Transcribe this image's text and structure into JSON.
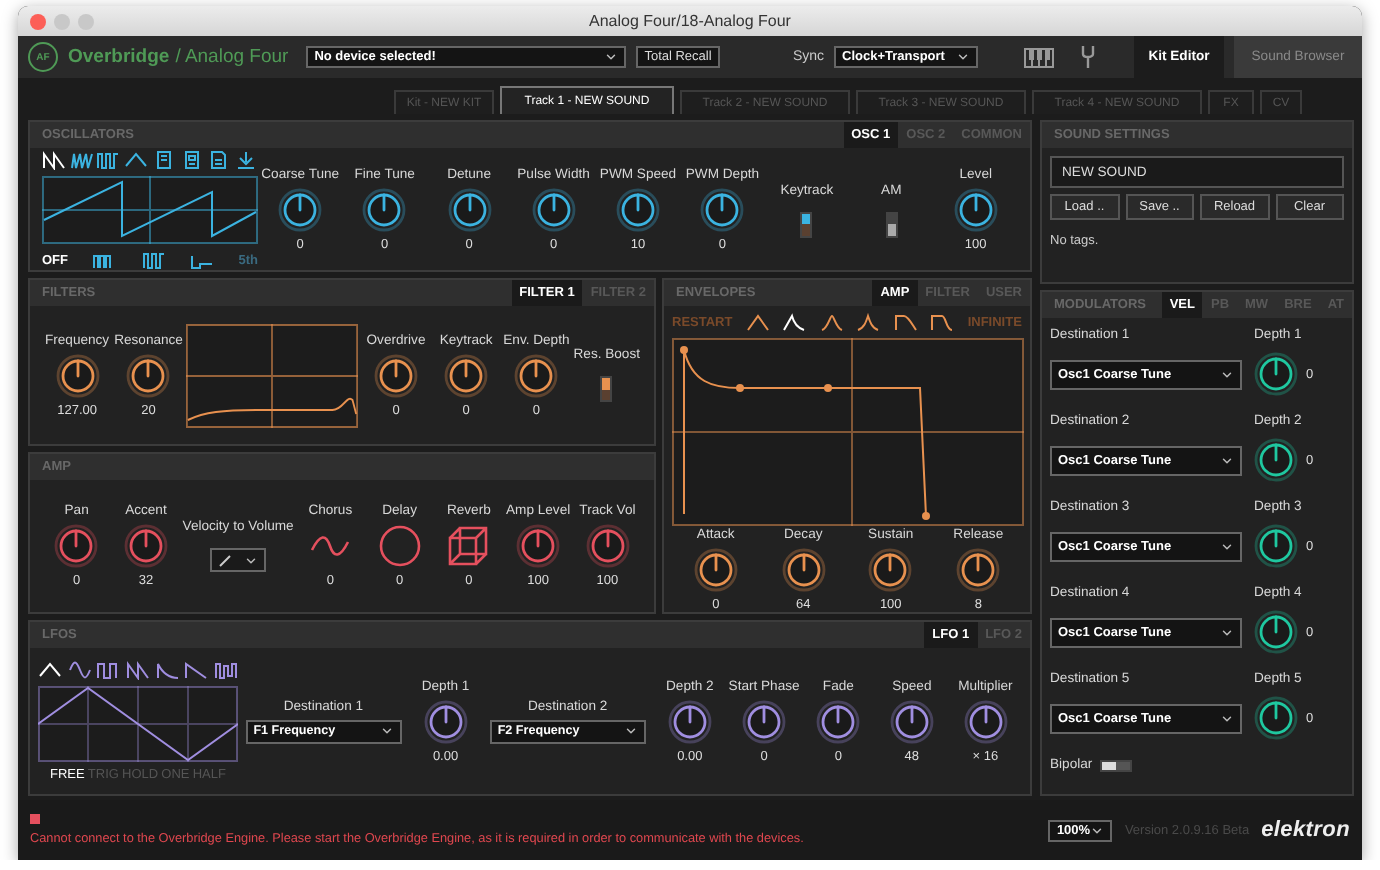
{
  "window": {
    "title": "Analog Four/18-Analog Four"
  },
  "header": {
    "logo": "AF",
    "brand": "Overbridge",
    "product": "/ Analog Four",
    "device": {
      "value": "No device selected!"
    },
    "total_recall": "Total Recall",
    "sync_label": "Sync",
    "sync": {
      "value": "Clock+Transport"
    },
    "views": [
      {
        "label": "Kit Editor",
        "selected": true
      },
      {
        "label": "Sound Browser",
        "selected": false
      }
    ]
  },
  "track_tabs": [
    {
      "label": "Kit - NEW KIT",
      "selected": false
    },
    {
      "label": "Track 1 - NEW SOUND",
      "selected": true
    },
    {
      "label": "Track 2 - NEW SOUND",
      "selected": false
    },
    {
      "label": "Track 3 - NEW SOUND",
      "selected": false
    },
    {
      "label": "Track 4 - NEW SOUND",
      "selected": false
    },
    {
      "label": "FX",
      "selected": false
    },
    {
      "label": "CV",
      "selected": false
    }
  ],
  "oscillators": {
    "title": "OSCILLATORS",
    "tabs": [
      {
        "label": "OSC 1",
        "selected": true
      },
      {
        "label": "OSC 2",
        "selected": false
      },
      {
        "label": "COMMON",
        "selected": false
      }
    ],
    "waveforms": [
      {
        "kind": "saw",
        "selected": true
      },
      {
        "kind": "pulse-sweep",
        "selected": false
      },
      {
        "kind": "pulse",
        "selected": false
      },
      {
        "kind": "triangle",
        "selected": false
      },
      {
        "kind": "noise",
        "selected": false
      },
      {
        "kind": "noise-alt",
        "selected": false
      },
      {
        "kind": "sample",
        "selected": false
      },
      {
        "kind": "input",
        "selected": false
      }
    ],
    "sub_modes": [
      {
        "kind": "text",
        "label": "OFF",
        "selected": true
      },
      {
        "kind": "pulse-stack",
        "selected": false
      },
      {
        "kind": "pulse",
        "selected": false
      },
      {
        "kind": "pulse-short",
        "selected": false
      },
      {
        "kind": "text",
        "label": "5th",
        "selected": false
      }
    ],
    "controls": [
      {
        "kind": "knob",
        "label": "Coarse Tune",
        "reading": "0"
      },
      {
        "kind": "knob",
        "label": "Fine Tune",
        "reading": "0"
      },
      {
        "kind": "knob",
        "label": "Detune",
        "reading": "0"
      },
      {
        "kind": "knob",
        "label": "Pulse Width",
        "reading": "0"
      },
      {
        "kind": "knob",
        "label": "PWM Speed",
        "reading": "10"
      },
      {
        "kind": "knob",
        "label": "PWM Depth",
        "reading": "0"
      },
      {
        "kind": "switch",
        "label": "Keytrack",
        "on": true
      },
      {
        "kind": "switch",
        "label": "AM",
        "on": false
      },
      {
        "kind": "knob",
        "label": "Level",
        "reading": "100"
      }
    ]
  },
  "filters": {
    "title": "FILTERS",
    "tabs": [
      {
        "label": "FILTER 1",
        "selected": true
      },
      {
        "label": "FILTER 2",
        "selected": false
      }
    ],
    "controls": [
      {
        "kind": "knob",
        "label": "Frequency",
        "reading": "127.00"
      },
      {
        "kind": "knob",
        "label": "Resonance",
        "reading": "20"
      },
      {
        "kind": "curve"
      },
      {
        "kind": "knob",
        "label": "Overdrive",
        "reading": "0"
      },
      {
        "kind": "knob",
        "label": "Keytrack",
        "reading": "0"
      },
      {
        "kind": "knob",
        "label": "Env. Depth",
        "reading": "0"
      },
      {
        "kind": "switch",
        "label": "Res. Boost",
        "on": true
      }
    ]
  },
  "amp": {
    "title": "AMP",
    "controls": [
      {
        "kind": "knob",
        "label": "Pan",
        "reading": "0"
      },
      {
        "kind": "knob",
        "label": "Accent",
        "reading": "32"
      },
      {
        "kind": "select",
        "label": "Velocity to Volume"
      },
      {
        "kind": "chorus",
        "label": "Chorus",
        "reading": "0"
      },
      {
        "kind": "delay",
        "label": "Delay",
        "reading": "0"
      },
      {
        "kind": "reverb",
        "label": "Reverb",
        "reading": "0"
      },
      {
        "kind": "knob",
        "label": "Amp Level",
        "reading": "100"
      },
      {
        "kind": "knob",
        "label": "Track Vol",
        "reading": "100"
      }
    ]
  },
  "envelopes": {
    "title": "ENVELOPES",
    "tabs": [
      {
        "label": "AMP",
        "selected": true
      },
      {
        "label": "FILTER",
        "selected": false
      },
      {
        "label": "USER",
        "selected": false
      }
    ],
    "shapes": [
      {
        "kind": "text",
        "label": "RESTART",
        "selected": false
      },
      {
        "kind": "attack-decay",
        "selected": false
      },
      {
        "kind": "attack-decay-sharp",
        "selected": true
      },
      {
        "kind": "attack-soft",
        "selected": false
      },
      {
        "kind": "attack-concave",
        "selected": false
      },
      {
        "kind": "gate-decay",
        "selected": false
      },
      {
        "kind": "gate",
        "selected": false
      },
      {
        "kind": "text",
        "label": "INFINITE",
        "selected": false
      }
    ],
    "controls": [
      {
        "kind": "knob",
        "label": "Attack",
        "reading": "0"
      },
      {
        "kind": "knob",
        "label": "Decay",
        "reading": "64"
      },
      {
        "kind": "knob",
        "label": "Sustain",
        "reading": "100"
      },
      {
        "kind": "knob",
        "label": "Release",
        "reading": "8"
      }
    ]
  },
  "lfos": {
    "title": "LFOS",
    "tabs": [
      {
        "label": "LFO 1",
        "selected": true
      },
      {
        "label": "LFO 2",
        "selected": false
      }
    ],
    "waveforms": [
      {
        "kind": "triangle",
        "selected": true
      },
      {
        "kind": "sine",
        "selected": false
      },
      {
        "kind": "square",
        "selected": false
      },
      {
        "kind": "saw",
        "selected": false
      },
      {
        "kind": "exp",
        "selected": false
      },
      {
        "kind": "ramp",
        "selected": false
      },
      {
        "kind": "random",
        "selected": false
      }
    ],
    "modes": [
      {
        "label": "FREE",
        "selected": true
      },
      {
        "label": "TRIG",
        "selected": false
      },
      {
        "label": "HOLD",
        "selected": false
      },
      {
        "label": "ONE",
        "selected": false
      },
      {
        "label": "HALF",
        "selected": false
      }
    ],
    "controls": [
      {
        "kind": "select",
        "label": "Destination 1",
        "value": "F1 Frequency"
      },
      {
        "kind": "knob",
        "label": "Depth 1",
        "reading": "0.00"
      },
      {
        "kind": "select",
        "label": "Destination 2",
        "value": "F2 Frequency"
      },
      {
        "kind": "knob",
        "label": "Depth 2",
        "reading": "0.00"
      },
      {
        "kind": "knob",
        "label": "Start Phase",
        "reading": "0"
      },
      {
        "kind": "knob",
        "label": "Fade",
        "reading": "0"
      },
      {
        "kind": "knob",
        "label": "Speed",
        "reading": "48"
      },
      {
        "kind": "knob",
        "label": "Multiplier",
        "reading": "× 16"
      }
    ]
  },
  "sound_settings": {
    "title": "SOUND SETTINGS",
    "name": "NEW SOUND",
    "buttons": [
      "Load ..",
      "Save ..",
      "Reload",
      "Clear"
    ],
    "tags": "No tags."
  },
  "modulators": {
    "title": "MODULATORS",
    "tabs": [
      {
        "label": "VEL",
        "selected": true
      },
      {
        "label": "PB",
        "selected": false
      },
      {
        "label": "MW",
        "selected": false
      },
      {
        "label": "BRE",
        "selected": false
      },
      {
        "label": "AT",
        "selected": false
      }
    ],
    "destinations": [
      {
        "label": "Destination 1",
        "value": "Osc1 Coarse Tune",
        "depth_label": "Depth 1",
        "reading": "0"
      },
      {
        "label": "Destination 2",
        "value": "Osc1 Coarse Tune",
        "depth_label": "Depth 2",
        "reading": "0"
      },
      {
        "label": "Destination 3",
        "value": "Osc1 Coarse Tune",
        "depth_label": "Depth 3",
        "reading": "0"
      },
      {
        "label": "Destination 4",
        "value": "Osc1 Coarse Tune",
        "depth_label": "Depth 4",
        "reading": "0"
      },
      {
        "label": "Destination 5",
        "value": "Osc1 Coarse Tune",
        "depth_label": "Depth 5",
        "reading": "0"
      }
    ],
    "bipolar": {
      "label": "Bipolar",
      "on": false
    }
  },
  "status_bar": {
    "error": "Cannot connect to the Overbridge Engine. Please start the Overbridge Engine, as it is required in order to communicate with the devices.",
    "zoom": "100%",
    "version": "Version 2.0.9.16 Beta",
    "brand": "elektron"
  }
}
